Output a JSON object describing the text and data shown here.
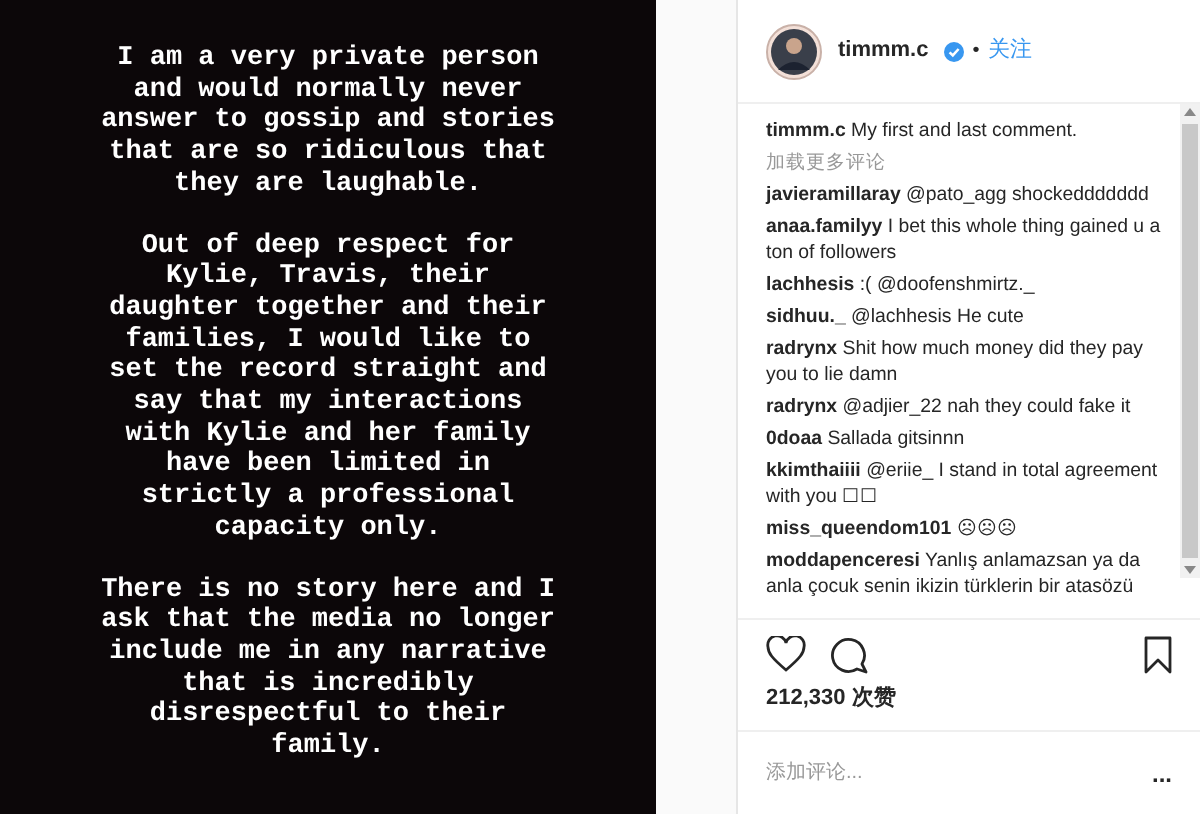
{
  "story": {
    "paragraphs": [
      [
        "I am a very private person",
        "and would normally never",
        "answer to gossip and stories",
        "that are so ridiculous that",
        "they are laughable."
      ],
      [
        "Out of deep respect for",
        "Kylie, Travis, their",
        "daughter together and their",
        "families, I would like to",
        "set the record straight and",
        "say that my interactions",
        "with Kylie and her family",
        "have been limited in",
        "strictly a professional",
        "capacity only."
      ],
      [
        "There is no story here and I",
        "ask that the media no longer",
        "include me in any narrative",
        "that is incredibly",
        "disrespectful to their",
        "family."
      ]
    ]
  },
  "header": {
    "username": "timmm.c",
    "verified": true,
    "separator": "•",
    "follow": "关注"
  },
  "caption": {
    "user": "timmm.c",
    "text": "My first and last comment."
  },
  "load_more": "加载更多评论",
  "comments": [
    {
      "user": "javieramillaray",
      "text": "@pato_agg shockeddddddd"
    },
    {
      "user": "anaa.familyy",
      "text": "I bet this whole thing gained u a ton of followers"
    },
    {
      "user": "lachhesis",
      "text": ":( @doofenshmirtz._"
    },
    {
      "user": "sidhuu._",
      "text": "@lachhesis He cute"
    },
    {
      "user": "radrynx",
      "text": "Shit how much money did they pay you to lie damn"
    },
    {
      "user": "radrynx",
      "text": "@adjier_22 nah they could fake it"
    },
    {
      "user": "0doaa",
      "text": "Sallada gitsinnn"
    },
    {
      "user": "kkimthaiiii",
      "text": "@eriie_ I stand in total agreement with you ☐☐"
    },
    {
      "user": "miss_queendom101",
      "text": "☹☹☹"
    },
    {
      "user": "moddapenceresi",
      "text": "Yanlış anlamazsan ya da anla çocuk senin ikizin türklerin bir atasözü"
    }
  ],
  "likes": "212,330 次赞",
  "add_comment": {
    "placeholder": "添加评论..."
  },
  "more": "..."
}
